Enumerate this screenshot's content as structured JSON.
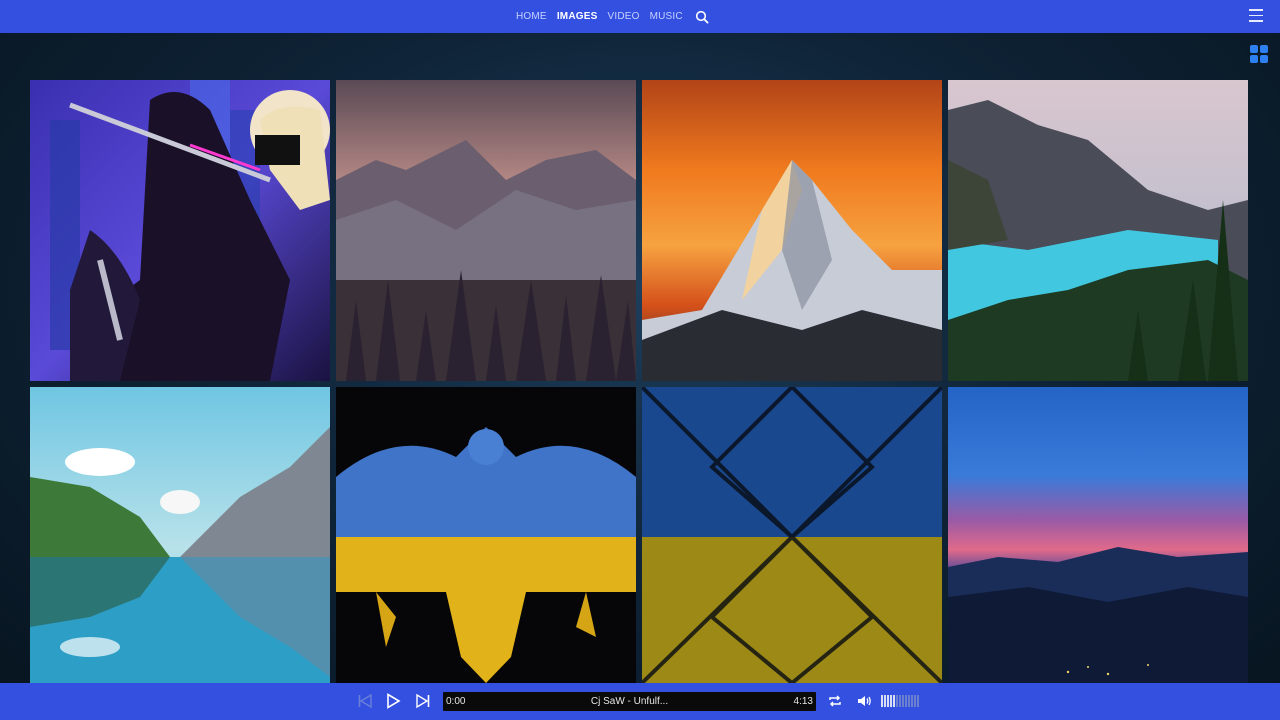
{
  "nav": {
    "items": [
      {
        "label": "HOME",
        "active": false
      },
      {
        "label": "IMAGES",
        "active": true
      },
      {
        "label": "VIDEO",
        "active": false
      },
      {
        "label": "MUSIC",
        "active": false
      }
    ],
    "search_icon": "search-icon",
    "menu_icon": "hamburger-menu-icon"
  },
  "view_toggle_icon": "grid-view-icon",
  "gallery": {
    "tiles": [
      {
        "subject": "cyberpunk-girl-with-sword"
      },
      {
        "subject": "misty-mountains-forest"
      },
      {
        "subject": "sunset-mountain-peak"
      },
      {
        "subject": "turquoise-lake-mountains"
      },
      {
        "subject": "mountain-lake-reflection"
      },
      {
        "subject": "ukraine-eagle-flag"
      },
      {
        "subject": "ukraine-flag-texture"
      },
      {
        "subject": "dusk-mountain-skyline"
      }
    ]
  },
  "player": {
    "current_time": "0:00",
    "track_title": "Cj SaW - Unfulf...",
    "duration": "4:13",
    "progress": 0,
    "volume_level": 0.4,
    "colors": {
      "bar": "#3350e0",
      "track_bg": "#0a0a0a"
    }
  },
  "colors": {
    "accent": "#3350e0",
    "grid_icon": "#2e7ff0"
  }
}
